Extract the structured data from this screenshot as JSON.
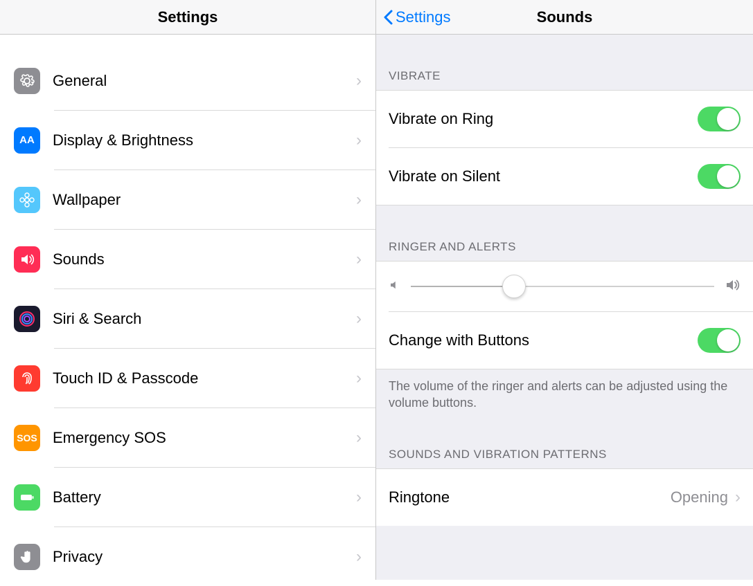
{
  "left": {
    "title": "Settings",
    "items": [
      {
        "label": "General"
      },
      {
        "label": "Display & Brightness"
      },
      {
        "label": "Wallpaper"
      },
      {
        "label": "Sounds"
      },
      {
        "label": "Siri & Search"
      },
      {
        "label": "Touch ID & Passcode"
      },
      {
        "label": "Emergency SOS"
      },
      {
        "label": "Battery"
      },
      {
        "label": "Privacy"
      }
    ]
  },
  "right": {
    "back_label": "Settings",
    "title": "Sounds",
    "vibrate_header": "Vibrate",
    "vibrate_on_ring": "Vibrate on Ring",
    "vibrate_on_silent": "Vibrate on Silent",
    "ringer_header": "Ringer and Alerts",
    "change_with_buttons": "Change with Buttons",
    "footer_note": "The volume of the ringer and alerts can be adjusted using the volume buttons.",
    "patterns_header": "Sounds and Vibration Patterns",
    "ringtone_label": "Ringtone",
    "ringtone_value": "Opening"
  }
}
